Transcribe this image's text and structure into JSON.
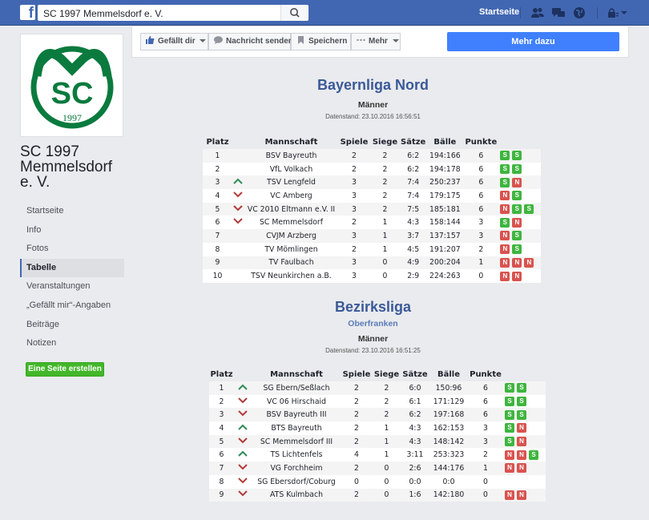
{
  "topbar": {
    "search_value": "SC 1997 Memmelsdorf e. V.",
    "home_label": "Startseite",
    "icons": [
      "friends-icon",
      "messages-icon",
      "globe-icon",
      "privacy-icon",
      "dropdown-icon"
    ]
  },
  "page": {
    "name": "SC 1997 Memmelsdorf e. V.",
    "logo_year": "1997"
  },
  "nav": {
    "items": [
      "Startseite",
      "Info",
      "Fotos",
      "Tabelle",
      "Veranstaltungen",
      "„Gefällt mir“-Angaben",
      "Beiträge",
      "Notizen"
    ],
    "active": "Tabelle",
    "create_label": "Eine Seite erstellen"
  },
  "actions": {
    "like": "Gefällt dir",
    "message": "Nachricht senden",
    "save": "Speichern",
    "more": "Mehr",
    "learn_more": "Mehr dazu"
  },
  "leagues": [
    {
      "title": "Bayernliga Nord",
      "subtitle": "",
      "category": "Männer",
      "stand": "Datenstand: 23.10.2016 16:56:51",
      "headers": [
        "Platz",
        "",
        "Mannschaft",
        "Spiele",
        "Siege",
        "Sätze",
        "Bälle",
        "Punkte",
        ""
      ],
      "rows": [
        {
          "platz": "1",
          "trend": "",
          "team": "BSV Bayreuth",
          "spiele": "2",
          "siege": "2",
          "saetze": "6:2",
          "baelle": "194:166",
          "punkte": "6",
          "results": [
            "S",
            "S"
          ]
        },
        {
          "platz": "2",
          "trend": "",
          "team": "VfL Volkach",
          "spiele": "2",
          "siege": "2",
          "saetze": "6:2",
          "baelle": "194:178",
          "punkte": "6",
          "results": [
            "S",
            "S"
          ]
        },
        {
          "platz": "3",
          "trend": "up",
          "team": "TSV Lengfeld",
          "spiele": "3",
          "siege": "2",
          "saetze": "7:4",
          "baelle": "250:237",
          "punkte": "6",
          "results": [
            "S",
            "N"
          ]
        },
        {
          "platz": "4",
          "trend": "down",
          "team": "VC Amberg",
          "spiele": "3",
          "siege": "2",
          "saetze": "7:4",
          "baelle": "179:175",
          "punkte": "6",
          "results": [
            "N",
            "S"
          ]
        },
        {
          "platz": "5",
          "trend": "down",
          "team": "VC 2010 Eltmann e.V. II",
          "spiele": "3",
          "siege": "2",
          "saetze": "7:5",
          "baelle": "185:181",
          "punkte": "6",
          "results": [
            "N",
            "S",
            "S"
          ]
        },
        {
          "platz": "6",
          "trend": "down",
          "team": "SC Memmelsdorf",
          "spiele": "2",
          "siege": "1",
          "saetze": "4:3",
          "baelle": "158:144",
          "punkte": "3",
          "results": [
            "S",
            "N"
          ]
        },
        {
          "platz": "7",
          "trend": "",
          "team": "CVJM Arzberg",
          "spiele": "3",
          "siege": "1",
          "saetze": "3:7",
          "baelle": "137:157",
          "punkte": "3",
          "results": [
            "N",
            "S"
          ]
        },
        {
          "platz": "8",
          "trend": "",
          "team": "TV Mömlingen",
          "spiele": "2",
          "siege": "1",
          "saetze": "4:5",
          "baelle": "191:207",
          "punkte": "2",
          "results": [
            "N",
            "S"
          ]
        },
        {
          "platz": "9",
          "trend": "",
          "team": "TV Faulbach",
          "spiele": "3",
          "siege": "0",
          "saetze": "4:9",
          "baelle": "200:204",
          "punkte": "1",
          "results": [
            "N",
            "N",
            "N"
          ]
        },
        {
          "platz": "10",
          "trend": "",
          "team": "TSV Neunkirchen a.B.",
          "spiele": "3",
          "siege": "0",
          "saetze": "2:9",
          "baelle": "224:263",
          "punkte": "0",
          "results": [
            "N",
            "N"
          ]
        }
      ]
    },
    {
      "title": "Bezirksliga",
      "subtitle": "Oberfranken",
      "category": "Männer",
      "stand": "Datenstand: 23.10.2016 16:51:25",
      "headers": [
        "Platz",
        "",
        "Mannschaft",
        "Spiele",
        "Siege",
        "Sätze",
        "Bälle",
        "Punkte",
        ""
      ],
      "rows": [
        {
          "platz": "1",
          "trend": "up",
          "team": "SG Ebern/Seßlach",
          "spiele": "2",
          "siege": "2",
          "saetze": "6:0",
          "baelle": "150:96",
          "punkte": "6",
          "results": [
            "S",
            "S"
          ]
        },
        {
          "platz": "2",
          "trend": "down",
          "team": "VC 06 Hirschaid",
          "spiele": "2",
          "siege": "2",
          "saetze": "6:1",
          "baelle": "171:129",
          "punkte": "6",
          "results": [
            "S",
            "S"
          ]
        },
        {
          "platz": "3",
          "trend": "down",
          "team": "BSV Bayreuth III",
          "spiele": "2",
          "siege": "2",
          "saetze": "6:2",
          "baelle": "197:168",
          "punkte": "6",
          "results": [
            "S",
            "S"
          ]
        },
        {
          "platz": "4",
          "trend": "up",
          "team": "BTS Bayreuth",
          "spiele": "2",
          "siege": "1",
          "saetze": "4:3",
          "baelle": "162:153",
          "punkte": "3",
          "results": [
            "S",
            "N"
          ]
        },
        {
          "platz": "5",
          "trend": "down",
          "team": "SC Memmelsdorf III",
          "spiele": "2",
          "siege": "1",
          "saetze": "4:3",
          "baelle": "148:142",
          "punkte": "3",
          "results": [
            "S",
            "N"
          ]
        },
        {
          "platz": "6",
          "trend": "up",
          "team": "TS Lichtenfels",
          "spiele": "4",
          "siege": "1",
          "saetze": "3:11",
          "baelle": "253:323",
          "punkte": "2",
          "results": [
            "N",
            "N",
            "S"
          ]
        },
        {
          "platz": "7",
          "trend": "down",
          "team": "VG Forchheim",
          "spiele": "2",
          "siege": "0",
          "saetze": "2:6",
          "baelle": "144:176",
          "punkte": "1",
          "results": [
            "N",
            "N"
          ]
        },
        {
          "platz": "8",
          "trend": "down",
          "team": "SG Ebersdorf/Coburg",
          "spiele": "0",
          "siege": "0",
          "saetze": "0:0",
          "baelle": "0:0",
          "punkte": "0",
          "results": []
        },
        {
          "platz": "9",
          "trend": "down",
          "team": "ATS Kulmbach",
          "spiele": "2",
          "siege": "0",
          "saetze": "1:6",
          "baelle": "142:180",
          "punkte": "0",
          "results": [
            "N",
            "N"
          ]
        }
      ]
    }
  ],
  "colors": {
    "facebook_blue": "#4267b2",
    "title_blue": "#3b5998",
    "win_green": "#3fb53f",
    "loss_red": "#d9534f",
    "trend_up": "#2e8b57",
    "trend_down": "#b33a3a",
    "logo_green": "#0a7a3e"
  }
}
